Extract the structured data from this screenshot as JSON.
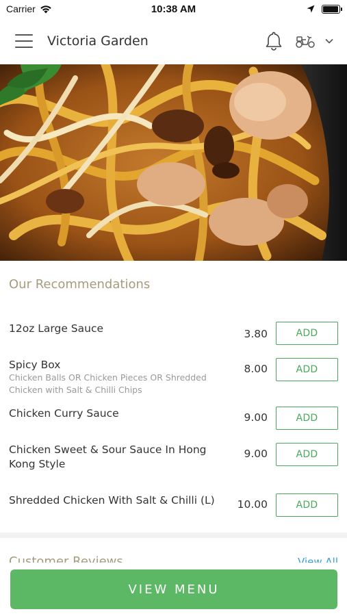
{
  "status_bar": {
    "carrier": "Carrier",
    "time": "10:38 AM",
    "battery_level": 0.95
  },
  "header": {
    "restaurant_name": "Victoria Garden",
    "icons": [
      "menu-icon",
      "bell-icon",
      "scooter-icon",
      "chevron-down-icon"
    ]
  },
  "recommendations": {
    "title": "Our Recommendations",
    "add_label": "ADD",
    "items": [
      {
        "name": "12oz Large Sauce",
        "description": "",
        "price": "3.80"
      },
      {
        "name": "Spicy Box",
        "description": "Chicken Balls OR Chicken Pieces OR Shredded Chicken with Salt & Chilli Chips",
        "price": "8.00"
      },
      {
        "name": "Chicken Curry Sauce",
        "description": "",
        "price": "9.00"
      },
      {
        "name": "Chicken Sweet & Sour Sauce In Hong Kong Style",
        "description": "",
        "price": "9.00"
      },
      {
        "name": "Shredded Chicken With Salt & Chilli (L)",
        "description": "",
        "price": "10.00"
      }
    ]
  },
  "reviews": {
    "title": "Customer Reviews",
    "view_all": "View All"
  },
  "footer": {
    "view_menu_label": "VIEW MENU"
  },
  "colors": {
    "accent_green": "#5cb865",
    "section_title": "#a59b7d",
    "link_blue": "#3a9fd6"
  }
}
